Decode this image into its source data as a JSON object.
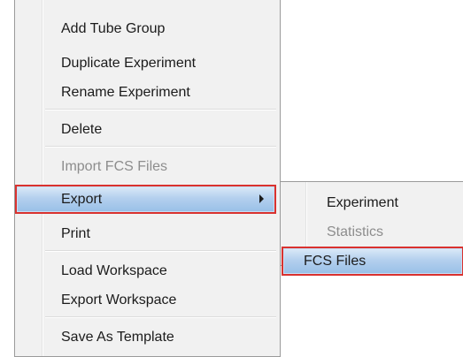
{
  "context_menu": {
    "items": [
      {
        "label": "Add Tube Group",
        "enabled": true
      },
      {
        "label": "Duplicate Experiment",
        "enabled": true
      },
      {
        "label": "Rename Experiment",
        "enabled": true
      },
      {
        "label": "Delete",
        "enabled": true
      },
      {
        "label": "Import FCS Files",
        "enabled": false
      },
      {
        "label": "Export",
        "enabled": true,
        "has_submenu": true,
        "highlighted": true
      },
      {
        "label": "Print",
        "enabled": true
      },
      {
        "label": "Load Workspace",
        "enabled": true
      },
      {
        "label": "Export Workspace",
        "enabled": true
      },
      {
        "label": "Save As Template",
        "enabled": true
      }
    ]
  },
  "submenu": {
    "items": [
      {
        "label": "Experiment",
        "enabled": true
      },
      {
        "label": "Statistics",
        "enabled": false
      },
      {
        "label": "FCS Files",
        "enabled": true,
        "highlighted": true
      }
    ]
  },
  "colors": {
    "menu_background": "#f1f1f1",
    "highlight_outline": "#d9322f",
    "highlight_fill": "#b4d0ee",
    "disabled_text": "#8d8d8d"
  }
}
